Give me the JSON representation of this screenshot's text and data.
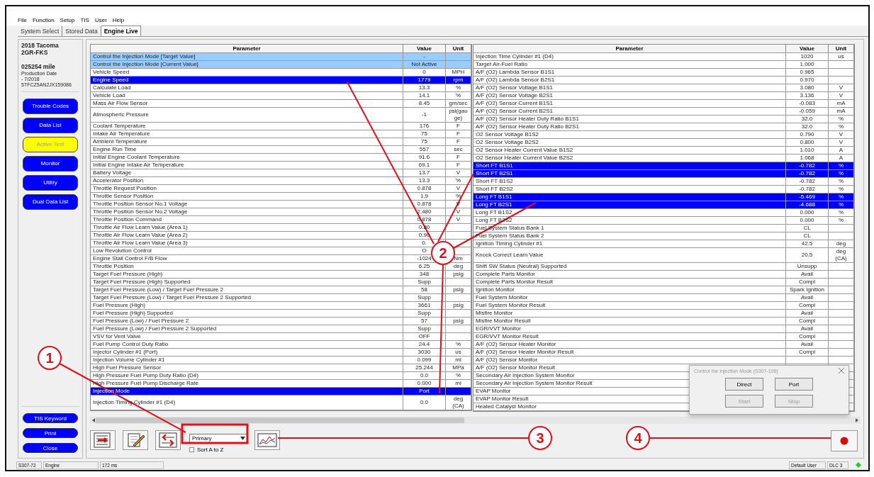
{
  "menu": [
    "File",
    "Function",
    "Setup",
    "TIS",
    "User",
    "Help"
  ],
  "tabs": [
    {
      "label": "System Select",
      "selected": false
    },
    {
      "label": "Stored Data",
      "selected": false
    },
    {
      "label": "Engine Live",
      "selected": true
    }
  ],
  "vehicle": {
    "model": "2018 Tacoma",
    "engine": "2GR-FKS",
    "mileage": "025254 mile",
    "production_label": "Production Date",
    "production_date": "- 7/2018",
    "vin": "5TFCZ5AN2JX159086"
  },
  "nav_buttons": [
    {
      "label": "Trouble Codes",
      "selected": false
    },
    {
      "label": "Data List",
      "selected": false
    },
    {
      "label": "Active Test",
      "selected": true
    },
    {
      "label": "Monitor",
      "selected": false
    },
    {
      "label": "Utility",
      "selected": false
    },
    {
      "label": "Dual Data List",
      "selected": false
    }
  ],
  "bottom_buttons": [
    "TIS Keyword",
    "Print",
    "Close"
  ],
  "tables": [
    {
      "columns": [
        "Parameter",
        "Value",
        "Unit"
      ],
      "rows": [
        {
          "parameter": "Control the Injection Mode [Target Value]",
          "value": "-",
          "kind": "control",
          "selected": false
        },
        {
          "parameter": "Control the Injection Mode [Current Value]",
          "value": "Not Active",
          "kind": "control",
          "selected": false
        },
        {
          "parameter": "Vehicle Speed",
          "value": "0",
          "unit": "MPH",
          "kind": "data",
          "selected": false
        },
        {
          "parameter": "Engine Speed",
          "value": "1779",
          "unit": "rpm",
          "kind": "data",
          "selected": true
        },
        {
          "parameter": "Calculate Load",
          "value": "13.3",
          "unit": "%",
          "kind": "data",
          "selected": false
        },
        {
          "parameter": "Vehicle Load",
          "value": "14.1",
          "unit": "%",
          "kind": "data",
          "selected": false
        },
        {
          "parameter": "Mass Air Flow Sensor",
          "value": "8.45",
          "unit": "gm/sec",
          "kind": "data",
          "selected": false
        },
        {
          "parameter": "Atmospheric Pressure",
          "value": "-1",
          "unit": "psi(gauge)",
          "kind": "data",
          "selected": false
        },
        {
          "parameter": "Coolant Temperature",
          "value": "176",
          "unit": "F",
          "kind": "data",
          "selected": false
        },
        {
          "parameter": "Intake Air Temperature",
          "value": "75",
          "unit": "F",
          "kind": "data",
          "selected": false
        },
        {
          "parameter": "Ambient Temperature",
          "value": "75",
          "unit": "F",
          "kind": "data",
          "selected": false
        },
        {
          "parameter": "Engine Run Time",
          "value": "557",
          "unit": "sec",
          "kind": "data",
          "selected": false
        },
        {
          "parameter": "Initial Engine Coolant Temperature",
          "value": "91.6",
          "unit": "F",
          "kind": "data",
          "selected": false
        },
        {
          "parameter": "Initial Engine Intake Air Temperature",
          "value": "69.1",
          "unit": "F",
          "kind": "data",
          "selected": false
        },
        {
          "parameter": "Battery Voltage",
          "value": "13.7",
          "unit": "V",
          "kind": "data",
          "selected": false
        },
        {
          "parameter": "Accelerator Position",
          "value": "13.3",
          "unit": "%",
          "kind": "data",
          "selected": false
        },
        {
          "parameter": "Throttle Request Position",
          "value": "0.878",
          "unit": "V",
          "kind": "data",
          "selected": false
        },
        {
          "parameter": "Throttle Sensor Position",
          "value": "1.9",
          "unit": "%",
          "kind": "data",
          "selected": false
        },
        {
          "parameter": "Throttle Position Sensor No.1 Voltage",
          "value": "0.878",
          "unit": "V",
          "kind": "data",
          "selected": false
        },
        {
          "parameter": "Throttle Position Sensor No.2 Voltage",
          "value": "2.480",
          "unit": "V",
          "kind": "data",
          "selected": false
        },
        {
          "parameter": "Throttle Position Command",
          "value": "0.878",
          "unit": "V",
          "kind": "data",
          "selected": false
        },
        {
          "parameter": "Throttle Air Flow Learn Value (Area 1)",
          "value": "0.80",
          "kind": "data",
          "selected": false
        },
        {
          "parameter": "Throttle Air Flow Learn Value (Area 2)",
          "value": "0.90",
          "kind": "data",
          "selected": false
        },
        {
          "parameter": "Throttle Air Flow Learn Value (Area 3)",
          "value": "0.",
          "kind": "data",
          "selected": false
        },
        {
          "parameter": "Low Revolution Control",
          "value": "O",
          "kind": "data",
          "selected": false
        },
        {
          "parameter": "Engine Stall Control F/B Flow",
          "value": "-1024",
          "unit": "Nm",
          "kind": "data",
          "selected": false
        },
        {
          "parameter": "Throttle Position",
          "value": "6.25",
          "unit": "deg",
          "kind": "data",
          "selected": false
        },
        {
          "parameter": "Target Fuel Pressure (High)",
          "value": "348",
          "unit": "psig",
          "kind": "data",
          "selected": false
        },
        {
          "parameter": "Target Fuel Pressure (High) Supported",
          "value": "Supp",
          "kind": "data",
          "selected": false
        },
        {
          "parameter": "Target Fuel Pressure (Low) / Target Fuel Pressure 2",
          "value": "58",
          "unit": "psig",
          "kind": "data",
          "selected": false
        },
        {
          "parameter": "Target Fuel Pressure (Low) / Target Fuel Pressure 2 Supported",
          "value": "Supp",
          "kind": "data",
          "selected": false
        },
        {
          "parameter": "Fuel Pressure (High)",
          "value": "3661",
          "unit": "psig",
          "kind": "data",
          "selected": false
        },
        {
          "parameter": "Fuel Pressure (High) Supported",
          "value": "Supp",
          "kind": "data",
          "selected": false
        },
        {
          "parameter": "Fuel Pressure (Low) / Fuel Pressure 2",
          "value": "57",
          "unit": "psig",
          "kind": "data",
          "selected": false
        },
        {
          "parameter": "Fuel Pressure (Low) / Fuel Pressure 2 Supported",
          "value": "Supp",
          "kind": "data",
          "selected": false
        },
        {
          "parameter": "VSV for Vent Valve",
          "value": "OFF",
          "kind": "data",
          "selected": false
        },
        {
          "parameter": "Fuel Pump Control Duty Ratio",
          "value": "24.4",
          "unit": "%",
          "kind": "data",
          "selected": false
        },
        {
          "parameter": "Injector Cylinder #1 (Port)",
          "value": "3030",
          "unit": "us",
          "kind": "data",
          "selected": false
        },
        {
          "parameter": "Injection Volume Cylinder #1",
          "value": "0.099",
          "unit": "ml",
          "kind": "data",
          "selected": false
        },
        {
          "parameter": "High Fuel Pressure Sensor",
          "value": "25.244",
          "unit": "MPa",
          "kind": "data",
          "selected": false
        },
        {
          "parameter": "High Pressure Fuel Pump Duty Ratio (D4)",
          "value": "0.0",
          "unit": "%",
          "kind": "data",
          "selected": false
        },
        {
          "parameter": "High Pressure Fuel Pump Discharge Rate",
          "value": "0.000",
          "unit": "ml",
          "kind": "data",
          "selected": false
        },
        {
          "parameter": "Injection Mode",
          "value": "Port",
          "kind": "data",
          "selected": true
        },
        {
          "parameter": "Injection Timing Cylinder #1 (D4)",
          "value": "0.0",
          "unit": "deg (CA)",
          "kind": "data",
          "selected": false
        }
      ]
    },
    {
      "columns": [
        "Parameter",
        "Value",
        "Unit"
      ],
      "rows": [
        {
          "parameter": "Injection Time Cylinder #1 (D4)",
          "value": "1020",
          "unit": "us",
          "kind": "data",
          "selected": false
        },
        {
          "parameter": "Target Air-Fuel Ratio",
          "value": "1.000",
          "kind": "data",
          "selected": false
        },
        {
          "parameter": "A/F (O2) Lambda Sensor B1S1",
          "value": "0.965",
          "kind": "data",
          "selected": false
        },
        {
          "parameter": "A/F (O2) Lambda Sensor B2S1",
          "value": "0.970",
          "kind": "data",
          "selected": false
        },
        {
          "parameter": "A/F (O2) Sensor Voltage B1S1",
          "value": "3.080",
          "unit": "V",
          "kind": "data",
          "selected": false
        },
        {
          "parameter": "A/F (O2) Sensor Voltage B2S1",
          "value": "3.136",
          "unit": "V",
          "kind": "data",
          "selected": false
        },
        {
          "parameter": "A/F (O2) Sensor Current B1S1",
          "value": "-0.083",
          "unit": "mA",
          "kind": "data",
          "selected": false
        },
        {
          "parameter": "A/F (O2) Sensor Current B2S1",
          "value": "-0.059",
          "unit": "mA",
          "kind": "data",
          "selected": false
        },
        {
          "parameter": "A/F (O2) Sensor Heater Duty Ratio B1S1",
          "value": "32.0",
          "unit": "%",
          "kind": "data",
          "selected": false
        },
        {
          "parameter": "A/F (O2) Sensor Heater Duty Ratio B2S1",
          "value": "32.0",
          "unit": "%",
          "kind": "data",
          "selected": false
        },
        {
          "parameter": "O2 Sensor Voltage B1S2",
          "value": "0.790",
          "unit": "V",
          "kind": "data",
          "selected": false
        },
        {
          "parameter": "O2 Sensor Voltage B2S2",
          "value": "0.800",
          "unit": "V",
          "kind": "data",
          "selected": false
        },
        {
          "parameter": "O2 Sensor Heater Current Value B1S2",
          "value": "1.010",
          "unit": "A",
          "kind": "data",
          "selected": false
        },
        {
          "parameter": "O2 Sensor Heater Current Value B2S2",
          "value": "1.068",
          "unit": "A",
          "kind": "data",
          "selected": false
        },
        {
          "parameter": "Short FT B1S1",
          "value": "-0.782",
          "unit": "%",
          "kind": "data",
          "selected": true
        },
        {
          "parameter": "Short FT B2S1",
          "value": "-0.782",
          "unit": "%",
          "kind": "data",
          "selected": true
        },
        {
          "parameter": "Short FT B1S2",
          "value": "-0.782",
          "unit": "%",
          "kind": "data",
          "selected": false
        },
        {
          "parameter": "Short FT B2S2",
          "value": "-0.782",
          "unit": "%",
          "kind": "data",
          "selected": false
        },
        {
          "parameter": "Long FT B1S1",
          "value": "-5.469",
          "unit": "%",
          "kind": "data",
          "selected": true
        },
        {
          "parameter": "Long FT B2S1",
          "value": "-4.688",
          "unit": "%",
          "kind": "data",
          "selected": true
        },
        {
          "parameter": "Long FT B1S2",
          "value": "0.000",
          "unit": "%",
          "kind": "data",
          "selected": false
        },
        {
          "parameter": "Long FT B2S2",
          "value": "0.000",
          "unit": "%",
          "kind": "data",
          "selected": false
        },
        {
          "parameter": "Fuel System Status Bank 1",
          "value": "CL",
          "kind": "data",
          "selected": false
        },
        {
          "parameter": "Fuel System Status Bank 2",
          "value": "CL",
          "kind": "data",
          "selected": false
        },
        {
          "parameter": "Ignition Timing Cylinder #1",
          "value": "42.5",
          "unit": "deg",
          "kind": "data",
          "selected": false
        },
        {
          "parameter": "Knock Correct Learn Value",
          "value": "20.5",
          "unit": "deg (CA)",
          "kind": "data",
          "selected": false
        },
        {
          "parameter": "Shift SW Status (Neutral) Supported",
          "value": "Unsupp",
          "kind": "data",
          "selected": false
        },
        {
          "parameter": "Complete Parts Monitor",
          "value": "Avail",
          "kind": "data",
          "selected": false
        },
        {
          "parameter": "Complete Parts Monitor Result",
          "value": "Compl",
          "kind": "data",
          "selected": false
        },
        {
          "parameter": "Ignition Monitor",
          "value": "Spark Ignition",
          "kind": "data",
          "selected": false
        },
        {
          "parameter": "Fuel System Monitor",
          "value": "Avail",
          "kind": "data",
          "selected": false
        },
        {
          "parameter": "Fuel System Monitor Result",
          "value": "Compl",
          "kind": "data",
          "selected": false
        },
        {
          "parameter": "Misfire Monitor",
          "value": "Avail",
          "kind": "data",
          "selected": false
        },
        {
          "parameter": "Misfire Monitor Result",
          "value": "Compl",
          "kind": "data",
          "selected": false
        },
        {
          "parameter": "EGR/VVT Monitor",
          "value": "Avail",
          "kind": "data",
          "selected": false
        },
        {
          "parameter": "EGR/VVT Monitor Result",
          "value": "Compl",
          "kind": "data",
          "selected": false
        },
        {
          "parameter": "A/F (O2) Sensor Heater Monitor",
          "value": "Avail",
          "kind": "data",
          "selected": false
        },
        {
          "parameter": "A/F (O2) Sensor Heater Monitor Result",
          "value": "Compl",
          "kind": "data",
          "selected": false
        },
        {
          "parameter": "A/F (O2) Sensor Monitor",
          "kind": "data",
          "selected": false
        },
        {
          "parameter": "A/F (O2) Sensor Monitor Result",
          "kind": "data",
          "selected": false
        },
        {
          "parameter": "Secondary Air Injection System Monitor",
          "kind": "data",
          "selected": false
        },
        {
          "parameter": "Secondary Air Injection System Monitor Result",
          "kind": "data",
          "selected": false
        },
        {
          "parameter": "EVAP Monitor",
          "kind": "data",
          "selected": false
        },
        {
          "parameter": "EVAP Monitor Result",
          "kind": "data",
          "selected": false
        },
        {
          "parameter": "Heated Catalyst Monitor",
          "kind": "data",
          "selected": false
        }
      ]
    }
  ],
  "toolbar": {
    "dropdown": {
      "value": "Primary"
    },
    "sort": {
      "label": "Sort A to Z",
      "checked": false
    }
  },
  "dialog": {
    "title": "Control the Injection Mode (S307-106)",
    "buttons": [
      {
        "label": "Direct",
        "disabled": false
      },
      {
        "label": "Port",
        "disabled": false
      },
      {
        "label": "Start",
        "disabled": true
      },
      {
        "label": "Stop",
        "disabled": true
      }
    ]
  },
  "status_bar": {
    "left": [
      "S307-72",
      "Engine",
      "172 ms"
    ],
    "right": [
      "Default User",
      "DLC 3"
    ]
  },
  "callouts": [
    "1",
    "2",
    "3",
    "4"
  ]
}
